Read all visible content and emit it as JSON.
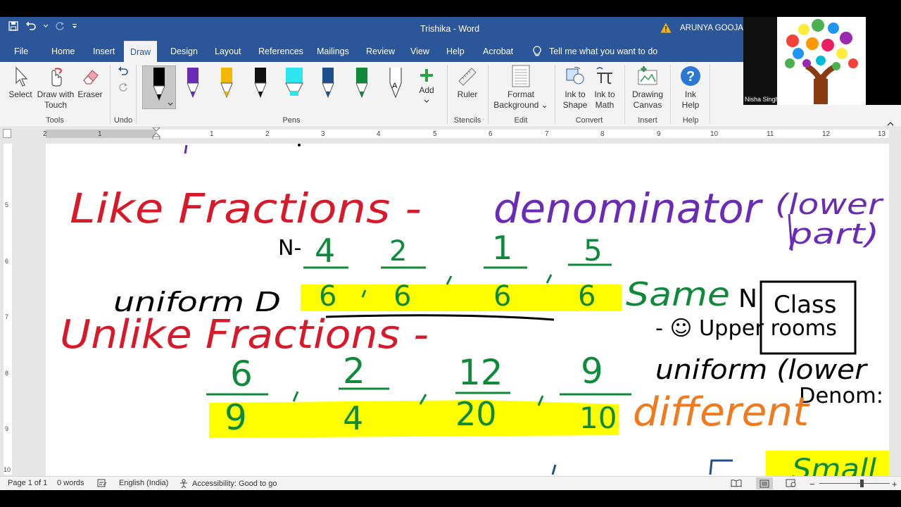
{
  "window": {
    "doc_title": "Trishika  -  Word",
    "user": "ARUNYA GOOJAR"
  },
  "tabs": [
    {
      "label": "File"
    },
    {
      "label": "Home"
    },
    {
      "label": "Insert"
    },
    {
      "label": "Draw"
    },
    {
      "label": "Design"
    },
    {
      "label": "Layout"
    },
    {
      "label": "References"
    },
    {
      "label": "Mailings"
    },
    {
      "label": "Review"
    },
    {
      "label": "View"
    },
    {
      "label": "Help"
    },
    {
      "label": "Acrobat"
    }
  ],
  "active_tab": "Draw",
  "tell_me": "Tell me what you want to do",
  "ribbon": {
    "tools": {
      "select": "Select",
      "draw_touch_1": "Draw with",
      "draw_touch_2": "Touch",
      "eraser": "Eraser",
      "group": "Tools"
    },
    "undo": {
      "group": "Undo"
    },
    "pens": {
      "group": "Pens",
      "add": "Add"
    },
    "stencils": {
      "ruler": "Ruler",
      "group": "Stencils"
    },
    "edit": {
      "format_bg_1": "Format",
      "format_bg_2": "Background",
      "group": "Edit"
    },
    "convert": {
      "ink_shape_1": "Ink to",
      "ink_shape_2": "Shape",
      "ink_math_1": "Ink to",
      "ink_math_2": "Math",
      "group": "Convert"
    },
    "insert": {
      "canvas_1": "Drawing",
      "canvas_2": "Canvas",
      "group": "Insert"
    },
    "help": {
      "ink_help_1": "Ink",
      "ink_help_2": "Help",
      "group": "Help"
    }
  },
  "pen_colors": [
    "#000000",
    "#6a2bb5",
    "#f2b705",
    "#111111",
    "#2ee6f0",
    "#1f4e8c",
    "#0f8a3a",
    "#ffffff"
  ],
  "ruler": {
    "numbers": [
      "2",
      "1",
      "1",
      "2",
      "3",
      "4",
      "5",
      "6",
      "7",
      "8",
      "9",
      "10",
      "11",
      "12",
      "13"
    ]
  },
  "vruler": {
    "numbers": [
      "5",
      "6",
      "7",
      "8",
      "9",
      "10"
    ]
  },
  "ink": {
    "like_fractions": "Like Fractions -",
    "denominator": "denominator",
    "lower_part_1": "(lower",
    "lower_part_2": "part)",
    "n_label": "N-",
    "uniform_d": "uniform  D",
    "like_nums": [
      "4",
      "2",
      "1",
      "5"
    ],
    "like_dens": [
      "6",
      "6",
      "6",
      "6"
    ],
    "same": "Same",
    "n_mark": "N",
    "class_word": "Class",
    "upper_rooms": "- ☺ Upper rooms",
    "unlike_fractions": "Unlike Fractions -",
    "unlike_nums": [
      "6",
      "2",
      "12",
      "9"
    ],
    "unlike_dens": [
      "9",
      "4",
      "20",
      "10"
    ],
    "different": "different",
    "uniform_lower": "uniform (lower",
    "denom": "Denom:",
    "small": "Small"
  },
  "colors": {
    "red": "#d8192a",
    "purple": "#6a2bb5",
    "green": "#0f8a3a",
    "orange": "#f07a1e",
    "highlight": "#ffff00",
    "ink_black": "#000000"
  },
  "status": {
    "page": "Page 1 of 1",
    "words": "0 words",
    "language": "English (India)",
    "accessibility": "Accessibility: Good to go"
  },
  "video": {
    "participant": "Nisha Singh"
  }
}
